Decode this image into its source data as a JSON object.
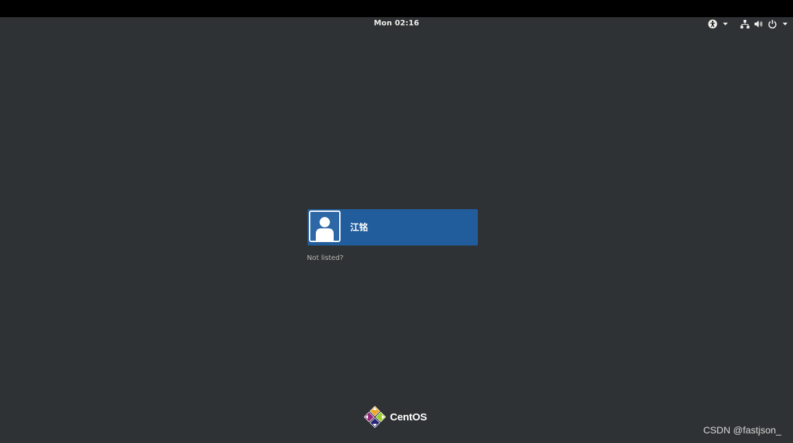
{
  "topbar": {
    "clock": "Mon 02:16",
    "icons": [
      "accessibility-icon",
      "network-icon",
      "volume-icon",
      "power-icon"
    ]
  },
  "login": {
    "users": [
      {
        "name": "江铭",
        "avatar": "default-user-avatar-icon"
      }
    ],
    "not_listed_label": "Not listed?"
  },
  "branding": {
    "logo": "centos-logo-icon",
    "name": "CentOS"
  },
  "watermark": "CSDN @fastjson_",
  "colors": {
    "background": "#2f3234",
    "topbar": "#000000",
    "user_card": "#215d9c",
    "text": "#eeeeec"
  }
}
